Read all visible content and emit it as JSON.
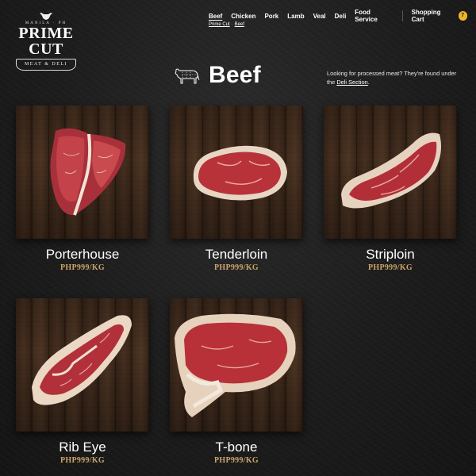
{
  "brand": {
    "est_text": "MANILA · PH",
    "name": "PRIME CUT",
    "tagline": "MEAT & DELI"
  },
  "nav": {
    "items": [
      {
        "label": "Beef",
        "active": true
      },
      {
        "label": "Chicken"
      },
      {
        "label": "Pork"
      },
      {
        "label": "Lamb"
      },
      {
        "label": "Veal"
      },
      {
        "label": "Deli"
      },
      {
        "label": "Food Service"
      }
    ],
    "cart_label": "Shopping Cart",
    "cart_count": "7"
  },
  "breadcrumb": {
    "home": "Prime Cut",
    "current": "Beef"
  },
  "page": {
    "title": "Beef",
    "notice_text": "Looking for processed meat? They're found under the ",
    "notice_link": "Deli Section",
    "notice_end": "."
  },
  "products": [
    {
      "name": "Porterhouse",
      "price": "PHP999/KG"
    },
    {
      "name": "Tenderloin",
      "price": "PHP999/KG"
    },
    {
      "name": "Striploin",
      "price": "PHP999/KG"
    },
    {
      "name": "Rib Eye",
      "price": "PHP999/KG"
    },
    {
      "name": "T-bone",
      "price": "PHP999/KG"
    }
  ],
  "colors": {
    "accent": "#f0b429",
    "price": "#c9a46a",
    "background": "#1c1c1c"
  }
}
